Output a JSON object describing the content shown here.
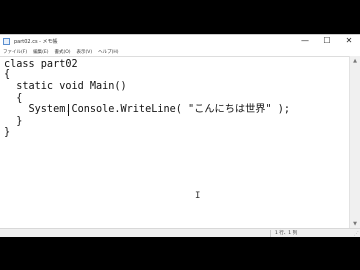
{
  "window": {
    "title": "part02.cs - メモ帳",
    "controls": {
      "minimize": "—",
      "maximize": "☐",
      "close": "✕"
    }
  },
  "menu": {
    "items": [
      "ファイル(F)",
      "編集(E)",
      "書式(O)",
      "表示(V)",
      "ヘルプ(H)"
    ]
  },
  "editor": {
    "lines": [
      "class part02",
      "{",
      "  static void Main()",
      "  {",
      "    System.Console.WriteLine( \"こんにちは世界\" );",
      "  }",
      "}"
    ]
  },
  "status": {
    "position": "1 行、1 列"
  },
  "scrollbar": {
    "up": "▲",
    "down": "▼"
  },
  "icons": {
    "app": "notepad-icon",
    "text_cursor": "I"
  }
}
